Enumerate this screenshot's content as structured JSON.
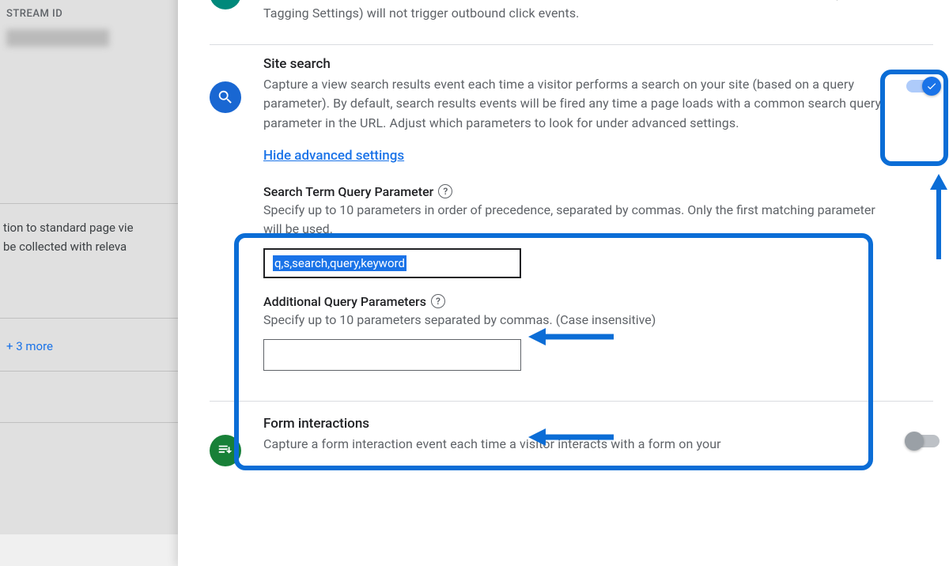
{
  "background": {
    "stream_label": "STREAM ID",
    "text1": "tion to standard page vie",
    "text2": "be collected with releva",
    "more": "+ 3 more"
  },
  "outbound": {
    "desc_partial": "leading away from the current domain. Links to domains configured for cross-domain measurement (in Tagging Settings) will not trigger outbound click events."
  },
  "site_search": {
    "title": "Site search",
    "desc": "Capture a view search results event each time a visitor performs a search on your site (based on a query parameter). By default, search results events will be fired any time a page loads with a common search query parameter in the URL. Adjust which parameters to look for under advanced settings.",
    "toggle_link": "Hide advanced settings",
    "param_label": "Search Term Query Parameter",
    "param_desc": "Specify up to 10 parameters in order of precedence, separated by commas. Only the first matching parameter will be used.",
    "param_value": "q,s,search,query,keyword",
    "additional_label": "Additional Query Parameters",
    "additional_desc": "Specify up to 10 parameters separated by commas. (Case insensitive)",
    "additional_value": ""
  },
  "form": {
    "title": "Form interactions",
    "desc": "Capture a form interaction event each time a visitor interacts with a form on your"
  }
}
